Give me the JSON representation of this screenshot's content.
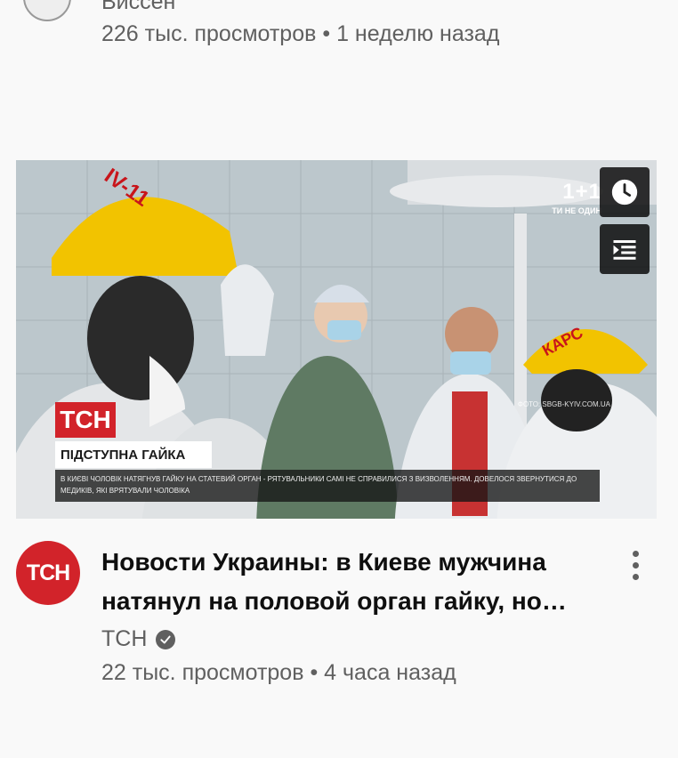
{
  "previous_video": {
    "channel": "Виссен",
    "views": "226 тыс. просмотров",
    "separator": "•",
    "age": "1 неделю назад"
  },
  "video": {
    "thumbnail": {
      "tag": "ТСН",
      "headline": "ПІДСТУПНА ГАЙКА",
      "ticker": "В КИЄВІ ЧОЛОВІК НАТЯГНУВ ГАЙКУ НА СТАТЕВИЙ ОРГАН - РЯТУВАЛЬНИКИ САМІ НЕ СПРАВИЛИСЯ З ВИЗВОЛЕННЯМ. ДОВЕЛОСЯ ЗВЕРНУТИСЯ ДО МЕДИКІВ, ЯКІ ВРЯТУВАЛИ ЧОЛОВІКА",
      "corner_logo": "1+1",
      "corner_sub": "ТИ НЕ ОДИН",
      "credit": "ФОТО: SBGB-KYIV.COM.UA",
      "helmet_left_text": "IV-11",
      "helmet_right_text": "КАРС"
    },
    "watch_later_icon": "clock-icon",
    "add_queue_icon": "playlist-add-icon",
    "channel_avatar_text": "ТСН",
    "title": "Новости Украины: в Киеве мужчина натянул на половой орган гайку, но…",
    "channel": "ТСН",
    "verified_icon": "check-circle-icon",
    "views": "22 тыс. просмотров",
    "separator": "•",
    "age": "4 часа назад",
    "menu_icon": "more-vertical-icon"
  },
  "colors": {
    "brand_red": "#d2232a",
    "text_primary": "#0f0f0f",
    "text_secondary": "#606060",
    "background": "#f9f9f9"
  }
}
